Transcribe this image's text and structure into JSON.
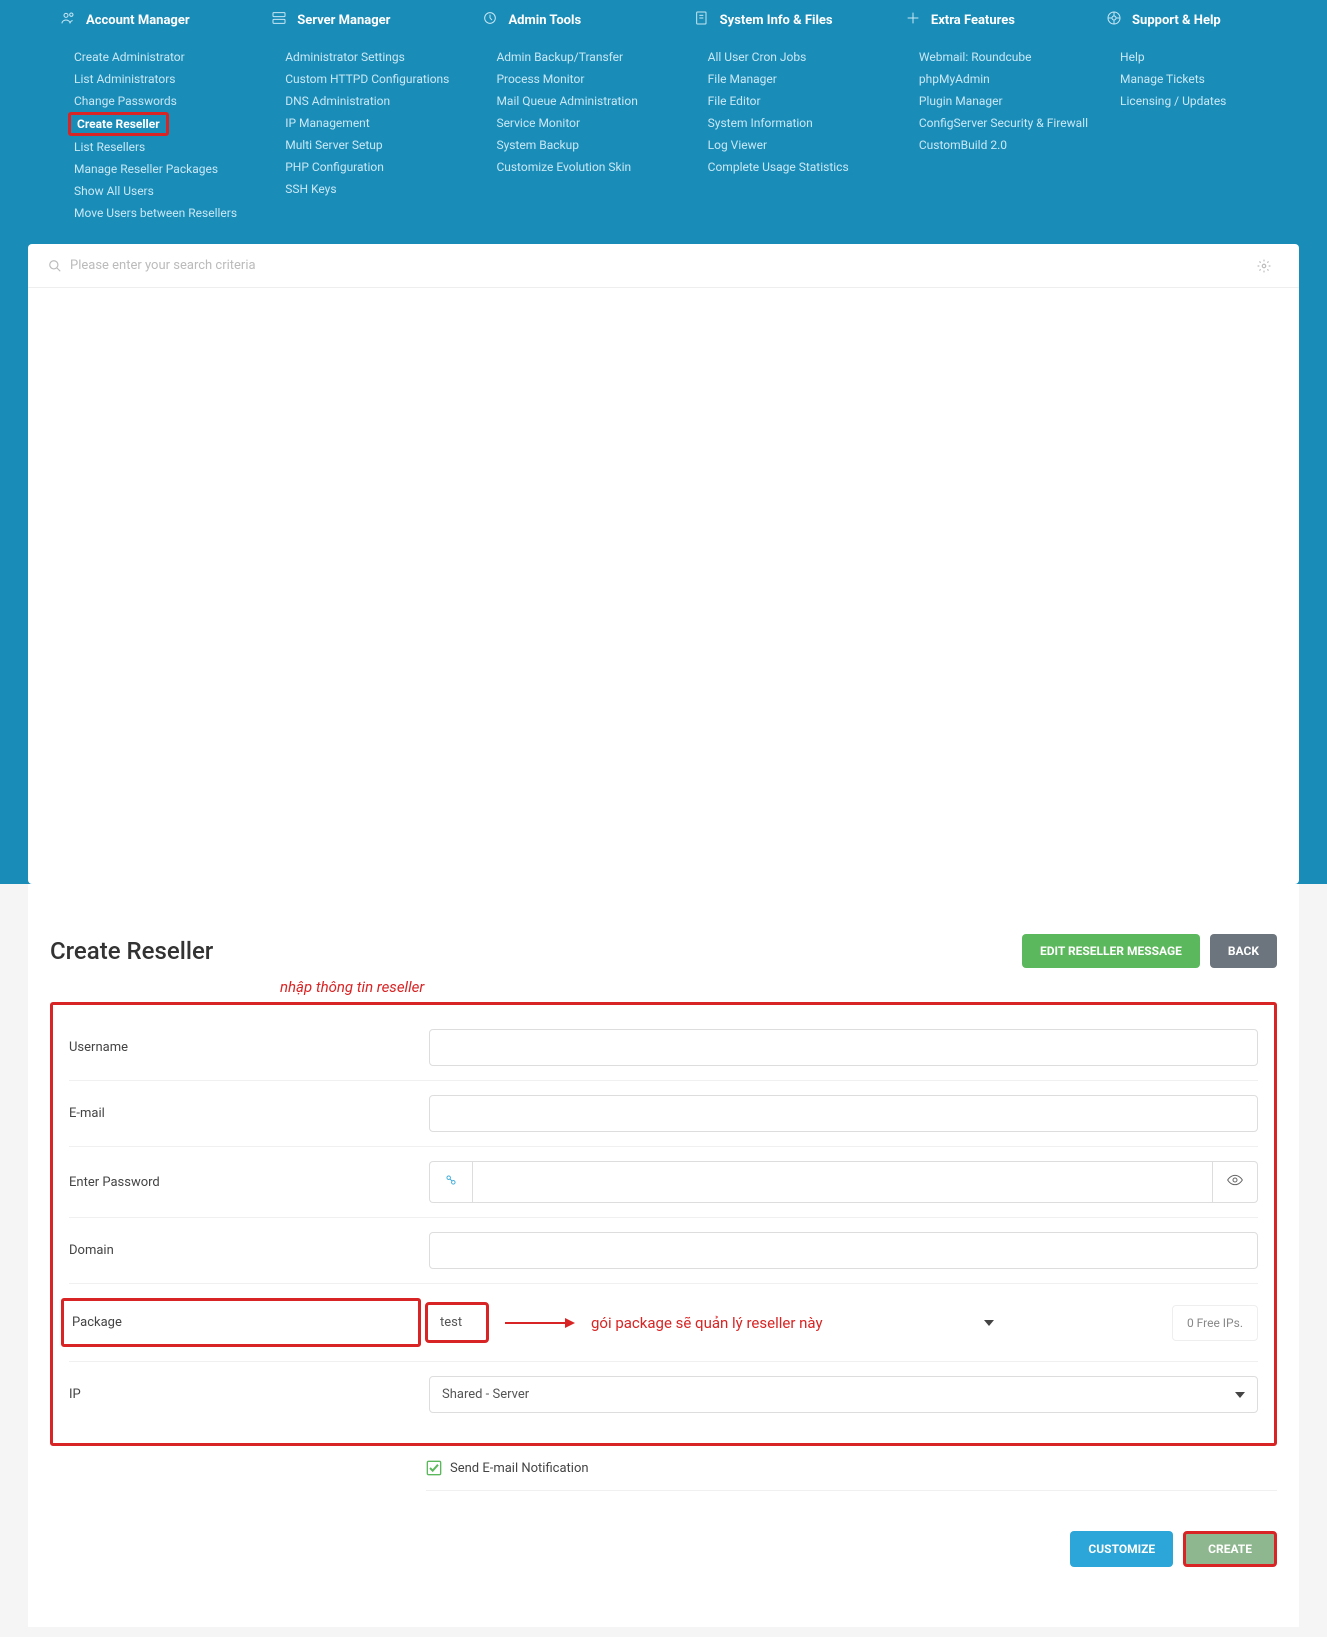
{
  "nav": {
    "columns": [
      {
        "title": "Account Manager",
        "icon": "users-icon",
        "links": [
          "Create Administrator",
          "List Administrators",
          "Change Passwords",
          "Create Reseller",
          "List Resellers",
          "Manage Reseller Packages",
          "Show All Users",
          "Move Users between Resellers"
        ],
        "highlighted": 3
      },
      {
        "title": "Server Manager",
        "icon": "server-icon",
        "links": [
          "Administrator Settings",
          "Custom HTTPD Configurations",
          "DNS Administration",
          "IP Management",
          "Multi Server Setup",
          "PHP Configuration",
          "SSH Keys"
        ]
      },
      {
        "title": "Admin Tools",
        "icon": "tools-icon",
        "links": [
          "Admin Backup/Transfer",
          "Process Monitor",
          "Mail Queue Administration",
          "Service Monitor",
          "System Backup",
          "Customize Evolution Skin"
        ]
      },
      {
        "title": "System Info & Files",
        "icon": "files-icon",
        "links": [
          "All User Cron Jobs",
          "File Manager",
          "File Editor",
          "System Information",
          "Log Viewer",
          "Complete Usage Statistics"
        ]
      },
      {
        "title": "Extra Features",
        "icon": "plus-icon",
        "links": [
          "Webmail: Roundcube",
          "phpMyAdmin",
          "Plugin Manager",
          "ConfigServer Security & Firewall",
          "CustomBuild 2.0"
        ]
      },
      {
        "title": "Support & Help",
        "icon": "support-icon",
        "links": [
          "Help",
          "Manage Tickets",
          "Licensing / Updates"
        ]
      }
    ]
  },
  "search": {
    "placeholder": "Please enter your search criteria"
  },
  "page": {
    "title": "Create Reseller",
    "edit_msg_btn": "EDIT RESELLER MESSAGE",
    "back_btn": "BACK",
    "annotation_top": "nhập thông tin reseller",
    "annotation_package": "gói package sẽ quản lý reseller này",
    "customize_btn": "CUSTOMIZE",
    "create_btn": "CREATE"
  },
  "form": {
    "username_label": "Username",
    "username_value": "",
    "email_label": "E-mail",
    "email_value": "",
    "password_label": "Enter Password",
    "password_value": "",
    "domain_label": "Domain",
    "domain_value": "",
    "package_label": "Package",
    "package_value": "test",
    "free_ips": "0 Free IPs.",
    "ip_label": "IP",
    "ip_value": "Shared - Server",
    "send_email_label": "Send E-mail Notification",
    "send_email_checked": true
  }
}
